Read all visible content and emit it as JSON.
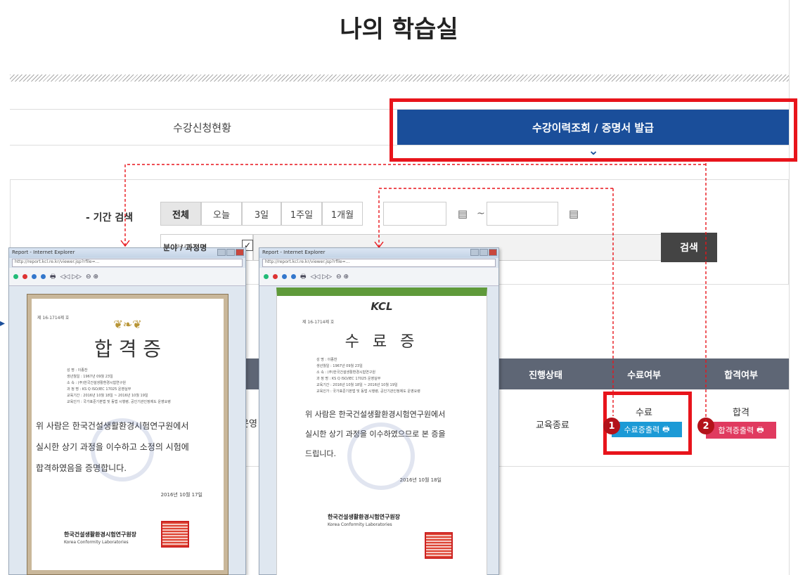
{
  "page": {
    "title": "나의 학습실"
  },
  "tabs": [
    {
      "label": "수강신청현황"
    },
    {
      "label": "수강이력조회 / 증명서 발급"
    }
  ],
  "search": {
    "period_label": "- 기간 검색",
    "period_buttons": [
      "전체",
      "오늘",
      "3일",
      "1주일",
      "1개월"
    ],
    "select_value": "검색",
    "button_label": "검색",
    "partial_label": "분야 / 과정명"
  },
  "table": {
    "headers": [
      "진행상태",
      "수료여부",
      "합격여부"
    ],
    "row": {
      "status": "교육종료",
      "completion": "수료",
      "pass": "합격",
      "completion_btn": "수료증출력",
      "pass_btn": "합격증출력",
      "partial": "운영"
    }
  },
  "markers": {
    "one": "1",
    "two": "2"
  },
  "window_left": {
    "title": "Report - Internet Explorer",
    "address": "http://report.kcl.re.kr/viewer.jsp?rfile=...",
    "cert_no": "제 16-1714제 호",
    "heading": "합 격 증",
    "fields": [
      "성    명 : 이종찬",
      "생년월일 : 1967년 09월 23일",
      "소    속 : (주)한국건설생활환경시험연구원",
      "과 정 명 : KS Q ISO/IEC 17025 운영실무",
      "교육기간 : 2016년 10월 18일 ~ 2016년 10월 19일",
      "교육인가 : 국가표준기본법 및 동법 시행령, 공인기관인정제도 운영요령"
    ],
    "body": [
      "위 사람은 한국건설생활환경시험연구원에서",
      "실시한 상기 과정을 이수하고 소정의 시험에",
      "합격하였음을 증명합니다."
    ],
    "date": "2016년 10월 17일",
    "org": "한국건설생활환경시험연구원장",
    "org_en": "Korea Conformity Laboratories"
  },
  "window_right": {
    "title": "Report - Internet Explorer",
    "address": "http://report.kcl.re.kr/viewer.jsp?rfile=...",
    "logo": "KCL",
    "cert_no": "제 16-1714제 호",
    "heading": "수 료 증",
    "fields": [
      "성    명 : 이종찬",
      "생년월일 : 1967년 09월 23일",
      "소    속 : (주)한국건설생활환경시험연구원",
      "과 정 명 : KS Q ISO/IEC 17025 운영실무",
      "교육기간 : 2016년 10월 18일 ~ 2016년 10월 19일",
      "교육인가 : 국가표준기본법 및 동법 시행령, 공인기관인정제도 운영요령"
    ],
    "body": [
      "위 사람은 한국건설생활환경시험연구원에서",
      "실시한 상기 과정을 이수하였으므로 본 증을",
      "드립니다."
    ],
    "date": "2016년 10월 18일",
    "org": "한국건설생활환경시험연구원장",
    "org_en": "Korea Conformity Laboratories"
  },
  "colors": {
    "accent": "#1a4e9a",
    "highlight": "#e8141b",
    "completion": "#1c9ad6",
    "pass": "#e03a5f",
    "table_header": "#5e6675"
  }
}
